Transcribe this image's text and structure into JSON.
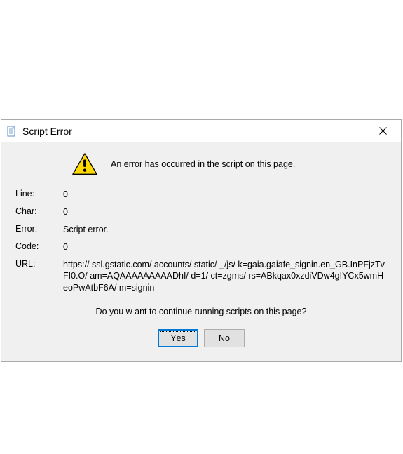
{
  "dialog": {
    "title": "Script Error",
    "header_message": "An error has occurred in the script on this page.",
    "labels": {
      "line": "Line:",
      "char": "Char:",
      "error": "Error:",
      "code": "Code:",
      "url": "URL:"
    },
    "values": {
      "line": "0",
      "char": "0",
      "error": "Script error.",
      "code": "0",
      "url": "https:// ssl.gstatic.com/ accounts/ static/ _/js/ k=gaia.gaiafe_signin.en_GB.InPFjzTvFI0.O/ am=AQAAAAAAAAADhI/ d=1/ ct=zgms/ rs=ABkqax0xzdiVDw4gIYCx5wmHeoPwAtbF6A/ m=signin"
    },
    "question": "Do you w ant to continue running scripts on this page?",
    "buttons": {
      "yes_prefix": "Y",
      "yes_rest": "es",
      "no_prefix": "N",
      "no_rest": "o"
    }
  }
}
